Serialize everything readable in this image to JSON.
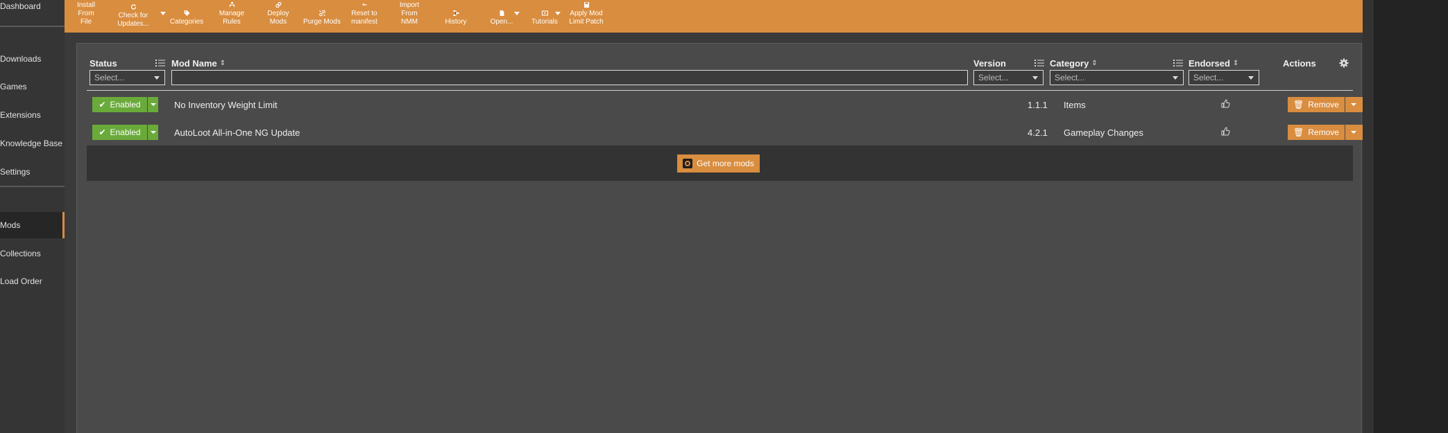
{
  "sidebar": {
    "items": [
      {
        "label": "Dashboard"
      },
      {
        "label": "Downloads"
      },
      {
        "label": "Games"
      },
      {
        "label": "Extensions"
      },
      {
        "label": "Knowledge Base"
      },
      {
        "label": "Settings"
      },
      {
        "label": "Mods"
      },
      {
        "label": "Collections"
      },
      {
        "label": "Load Order"
      }
    ]
  },
  "toolbar": {
    "buttons": [
      {
        "line1": "Install From",
        "line2": "File",
        "icon": "plus-icon"
      },
      {
        "line1": "Check for",
        "line2": "Updates...",
        "icon": "refresh-icon"
      },
      {
        "line1": "Categories",
        "line2": "",
        "icon": "tag-icon"
      },
      {
        "line1": "Manage",
        "line2": "Rules",
        "icon": "rules-icon"
      },
      {
        "line1": "Deploy Mods",
        "line2": "",
        "icon": "link-icon"
      },
      {
        "line1": "Purge Mods",
        "line2": "",
        "icon": "unlink-icon"
      },
      {
        "line1": "Reset to",
        "line2": "manifest",
        "icon": "reset-icon"
      },
      {
        "line1": "Import From",
        "line2": "NMM",
        "icon": "import-icon"
      },
      {
        "line1": "History",
        "line2": "",
        "icon": "history-icon"
      },
      {
        "line1": "Open...",
        "line2": "",
        "icon": "folder-icon"
      },
      {
        "line1": "Tutorials",
        "line2": "",
        "icon": "video-icon"
      },
      {
        "line1": "Apply Mod",
        "line2": "Limit Patch",
        "icon": "save-icon"
      }
    ]
  },
  "columns": {
    "status": "Status",
    "mod_name": "Mod Name",
    "version": "Version",
    "category": "Category",
    "endorsed": "Endorsed",
    "actions": "Actions"
  },
  "filters": {
    "status_placeholder": "Select...",
    "mod_name_value": "",
    "version_placeholder": "Select...",
    "category_placeholder": "Select...",
    "endorsed_placeholder": "Select..."
  },
  "mods": [
    {
      "status": "Enabled",
      "name": "No Inventory Weight Limit",
      "version": "1.1.1",
      "category": "Items",
      "action": "Remove"
    },
    {
      "status": "Enabled",
      "name": "AutoLoot All-in-One NG Update",
      "version": "4.2.1",
      "category": "Gameplay Changes",
      "action": "Remove"
    }
  ],
  "get_more_mods": "Get more mods",
  "colors": {
    "accent": "#d98d3f",
    "enabled": "#6aaa3a",
    "background": "#4a4a4a"
  }
}
